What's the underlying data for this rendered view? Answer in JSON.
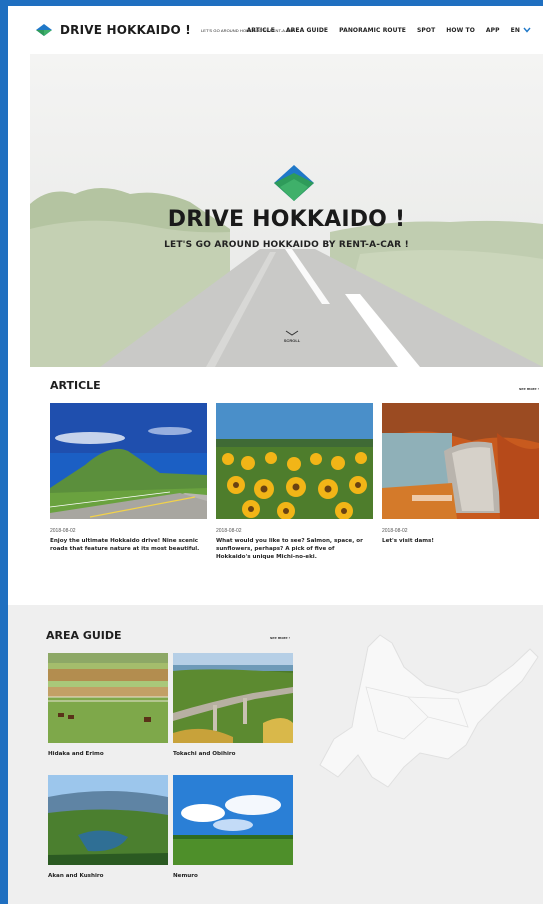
{
  "nav": {
    "logo": "DRIVE HOKKAIDO !",
    "tagline": "LET'S GO AROUND HOKKAIDO BY RENT-A-CAR !",
    "items": [
      "ARTICLE",
      "AREA GUIDE",
      "PANORAMIC ROUTE",
      "SPOT",
      "HOW TO",
      "APP"
    ],
    "lang": "EN"
  },
  "hero": {
    "title": "DRIVE HOKKAIDO !",
    "subtitle": "LET'S GO AROUND HOKKAIDO BY RENT-A-CAR !",
    "scroll": "SCROLL"
  },
  "article": {
    "heading": "ARTICLE",
    "see_more": "see more ›",
    "cards": [
      {
        "date": "2018-08-02",
        "title": "Enjoy the ultimate Hokkaido drive! Nine scenic roads that feature nature at its most beautiful."
      },
      {
        "date": "2018-08-02",
        "title": "What would you like to see? Salmon, space, or sunflowers, perhaps? A pick of five of Hokkaido's unique Michi-no-eki."
      },
      {
        "date": "2018-08-02",
        "title": "Let's visit dams!"
      }
    ]
  },
  "area_guide": {
    "heading": "AREA GUIDE",
    "see_more": "see more ›",
    "areas": [
      "Hidaka and Erimo",
      "Tokachi and Obihiro",
      "Akan and Kushiro",
      "Nemuro"
    ]
  },
  "colors": {
    "frame": "#1f6fc0",
    "accent_green": "#2e9b5a",
    "accent_blue": "#1f78c8",
    "area_bg": "#efefef"
  }
}
